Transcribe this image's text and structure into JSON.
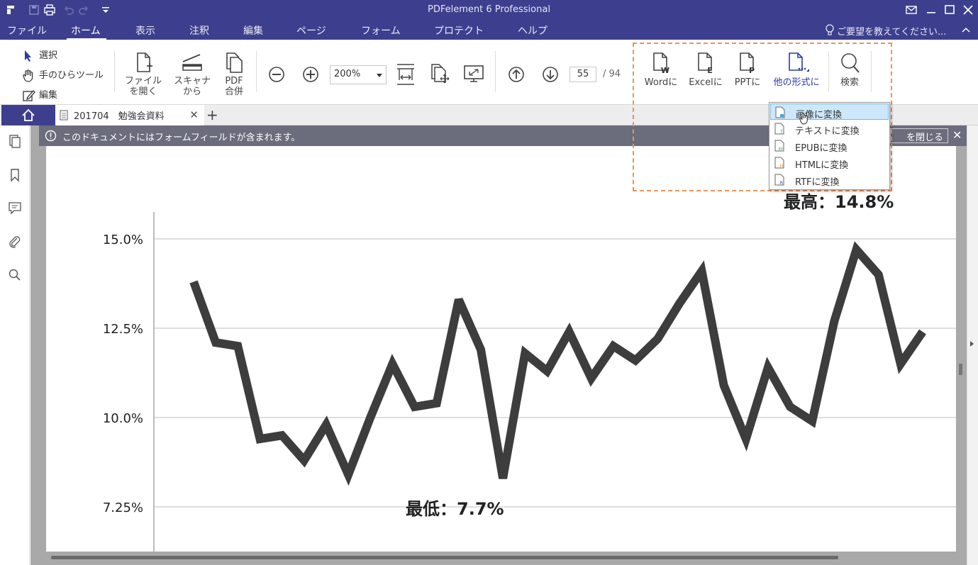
{
  "app": {
    "title": "PDFelement 6 Professional"
  },
  "menu": {
    "items": [
      "ファイル",
      "ホーム",
      "表示",
      "注釈",
      "編集",
      "ページ",
      "フォーム",
      "プロテクト",
      "ヘルプ"
    ],
    "active": "ホーム",
    "hint": "ご要望を教えてください..."
  },
  "ribbon": {
    "select": "選択",
    "hand": "手のひらツール",
    "edit": "編集",
    "open_file": [
      "ファイル",
      "を開く"
    ],
    "scanner": [
      "スキャナ",
      "から"
    ],
    "pdf_merge": [
      "PDF",
      "合併"
    ],
    "zoom": "200%",
    "page_current": "55",
    "page_total": "/  94",
    "to_word": "Wordに",
    "to_excel": "Excelに",
    "to_ppt": "PPTに",
    "to_other": "他の形式に",
    "search": "検索"
  },
  "tabs": {
    "doc_title": "201704　勉強会資料"
  },
  "notification": {
    "text": "このドキュメントにはフォームフィールドが含まれます。",
    "close_button": "を閉じる"
  },
  "dropdown": {
    "items": [
      "画像に変換",
      "テキストに変換",
      "EPUBに変換",
      "HTMLに変換",
      "RTFに変換"
    ],
    "selected_index": 0
  },
  "chart_data": {
    "type": "line",
    "title": "",
    "xlabel": "",
    "ylabel": "",
    "yticks": [
      "15.0%",
      "12.5%",
      "10.0%",
      "7.25%"
    ],
    "ytick_values": [
      15.0,
      12.5,
      10.0,
      7.5
    ],
    "ylim": [
      7.0,
      15.6
    ],
    "x": [
      1,
      2,
      3,
      4,
      5,
      6,
      7,
      8,
      9,
      10,
      11,
      12,
      13,
      14,
      15,
      16,
      17,
      18,
      19,
      20,
      21,
      22,
      23,
      24,
      25,
      26,
      27,
      28,
      29,
      30,
      31,
      32,
      33,
      34,
      35,
      36,
      37,
      38
    ],
    "series": [
      {
        "values": [
          13.8,
          12.1,
          12.0,
          9.4,
          9.5,
          8.8,
          9.8,
          8.4,
          10.0,
          11.5,
          10.3,
          10.4,
          13.3,
          11.9,
          8.3,
          11.8,
          11.3,
          12.4,
          11.1,
          12.0,
          11.6,
          12.2,
          13.2,
          14.1,
          10.9,
          9.4,
          11.4,
          10.3,
          9.9,
          12.7,
          14.7,
          14.0,
          11.5,
          12.4
        ]
      }
    ],
    "annotations": [
      {
        "text": "最高：14.8%"
      },
      {
        "text": "最低：7.7%"
      }
    ]
  }
}
